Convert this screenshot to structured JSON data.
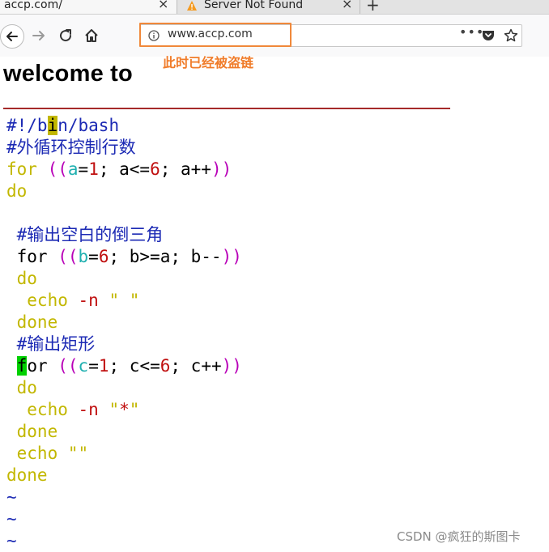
{
  "browser": {
    "tabs": [
      {
        "title": "accp.com/",
        "close": "×"
      },
      {
        "title": "Server Not Found",
        "close": "×"
      }
    ],
    "new_tab": "+",
    "url": "www.accp.com",
    "menu_dots": "•••",
    "annotation": "此时已经被盗链",
    "accent_color": "#f0883a"
  },
  "page": {
    "heading": "welcome to"
  },
  "code_lines": [
    [
      {
        "t": "#!/b",
        "c": "c-comment"
      },
      {
        "t": "i",
        "c": "cursor-y"
      },
      {
        "t": "n/bash",
        "c": "c-comment"
      }
    ],
    [
      {
        "t": "#外循环控制行数",
        "c": "c-comment"
      }
    ],
    [
      {
        "t": "for",
        "c": "c-kw"
      },
      {
        "t": " ",
        "c": ""
      },
      {
        "t": "((",
        "c": "c-paren"
      },
      {
        "t": "a",
        "c": "c-var"
      },
      {
        "t": "=",
        "c": ""
      },
      {
        "t": "1",
        "c": "c-num"
      },
      {
        "t": "; a<=",
        "c": ""
      },
      {
        "t": "6",
        "c": "c-num"
      },
      {
        "t": "; a++",
        "c": ""
      },
      {
        "t": "))",
        "c": "c-paren"
      }
    ],
    [
      {
        "t": "do",
        "c": "c-kw"
      }
    ],
    [
      {
        "t": "",
        "c": ""
      }
    ],
    [
      {
        "t": " #输出空白的倒三角",
        "c": "c-comment"
      }
    ],
    [
      {
        "t": " for ",
        "c": ""
      },
      {
        "t": "((",
        "c": "c-paren"
      },
      {
        "t": "b",
        "c": "c-var"
      },
      {
        "t": "=",
        "c": ""
      },
      {
        "t": "6",
        "c": "c-num"
      },
      {
        "t": "; b>=a; b--",
        "c": ""
      },
      {
        "t": "))",
        "c": "c-paren"
      }
    ],
    [
      {
        "t": " do",
        "c": "c-kw"
      }
    ],
    [
      {
        "t": "  echo ",
        "c": "c-kw"
      },
      {
        "t": "-n",
        "c": "c-num"
      },
      {
        "t": " ",
        "c": ""
      },
      {
        "t": "\" \"",
        "c": "c-kw"
      }
    ],
    [
      {
        "t": " done",
        "c": "c-kw"
      }
    ],
    [
      {
        "t": " #输出矩形",
        "c": "c-comment"
      }
    ],
    [
      {
        "t": " ",
        "c": ""
      },
      {
        "t": "f",
        "c": "cursor-g"
      },
      {
        "t": "or ",
        "c": ""
      },
      {
        "t": "((",
        "c": "c-paren"
      },
      {
        "t": "c",
        "c": "c-var"
      },
      {
        "t": "=",
        "c": ""
      },
      {
        "t": "1",
        "c": "c-num"
      },
      {
        "t": "; c<=",
        "c": ""
      },
      {
        "t": "6",
        "c": "c-num"
      },
      {
        "t": "; c++",
        "c": ""
      },
      {
        "t": "))",
        "c": "c-paren"
      }
    ],
    [
      {
        "t": " do",
        "c": "c-kw"
      }
    ],
    [
      {
        "t": "  echo ",
        "c": "c-kw"
      },
      {
        "t": "-n",
        "c": "c-num"
      },
      {
        "t": " ",
        "c": ""
      },
      {
        "t": "\"",
        "c": "c-kw"
      },
      {
        "t": "*",
        "c": "c-str"
      },
      {
        "t": "\"",
        "c": "c-kw"
      }
    ],
    [
      {
        "t": " done",
        "c": "c-kw"
      }
    ],
    [
      {
        "t": " echo ",
        "c": "c-kw"
      },
      {
        "t": "\"\"",
        "c": "c-kw"
      }
    ],
    [
      {
        "t": "done",
        "c": "c-kw"
      }
    ],
    [
      {
        "t": "~",
        "c": "c-tilde"
      }
    ],
    [
      {
        "t": "~",
        "c": "c-tilde"
      }
    ],
    [
      {
        "t": "~",
        "c": "c-tilde"
      }
    ]
  ],
  "watermark": "CSDN @疯狂的斯图卡"
}
